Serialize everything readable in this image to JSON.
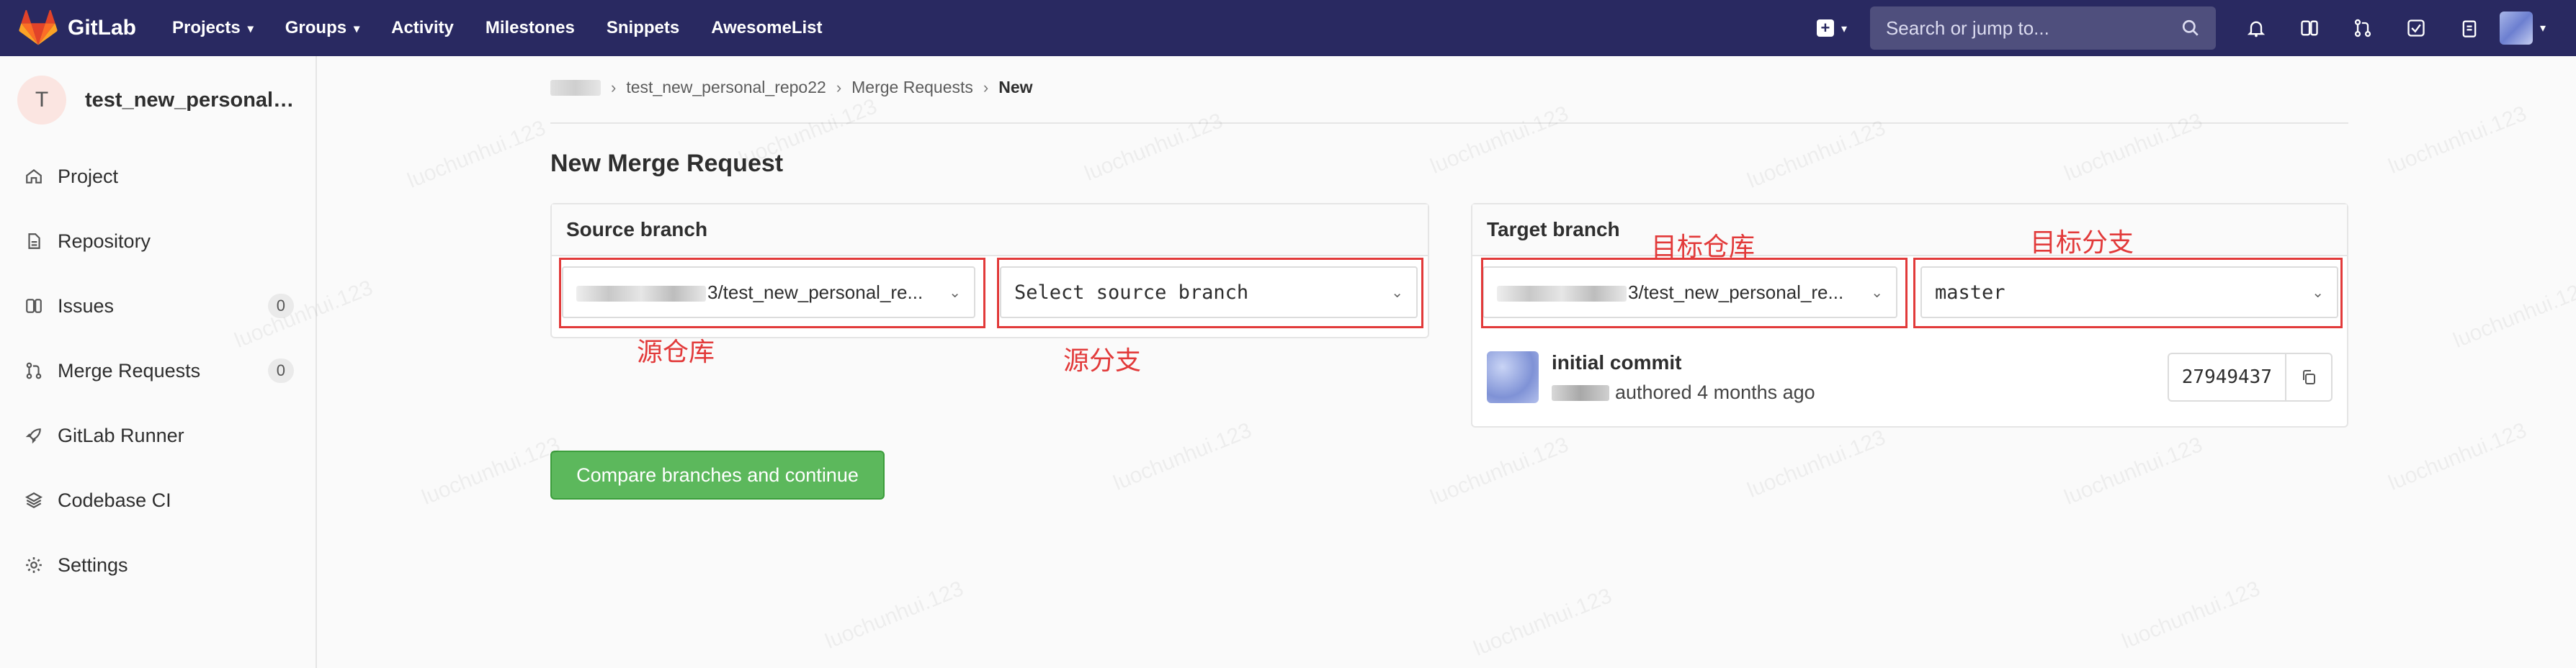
{
  "topnav": {
    "brand": "GitLab",
    "links": [
      {
        "label": "Projects",
        "has_dropdown": true
      },
      {
        "label": "Groups",
        "has_dropdown": true
      },
      {
        "label": "Activity",
        "has_dropdown": false
      },
      {
        "label": "Milestones",
        "has_dropdown": false
      },
      {
        "label": "Snippets",
        "has_dropdown": false
      },
      {
        "label": "AwesomeList",
        "has_dropdown": false
      }
    ],
    "search_placeholder": "Search or jump to...",
    "icons": [
      "plus-icon",
      "search-icon",
      "issues-icon",
      "todo-icon",
      "merge-request-icon",
      "check-icon",
      "clipboard-icon",
      "user-avatar"
    ]
  },
  "sidebar": {
    "avatar_letter": "T",
    "project_name": "test_new_personal_...",
    "items": [
      {
        "label": "Project",
        "icon": "home-icon"
      },
      {
        "label": "Repository",
        "icon": "document-icon"
      },
      {
        "label": "Issues",
        "icon": "issues-icon",
        "count": "0"
      },
      {
        "label": "Merge Requests",
        "icon": "merge-request-icon",
        "count": "0"
      },
      {
        "label": "GitLab Runner",
        "icon": "rocket-icon"
      },
      {
        "label": "Codebase CI",
        "icon": "layers-icon"
      },
      {
        "label": "Settings",
        "icon": "gear-icon"
      }
    ]
  },
  "breadcrumb": {
    "repo": "test_new_personal_repo22",
    "section": "Merge Requests",
    "current": "New"
  },
  "page_title": "New Merge Request",
  "source": {
    "header": "Source branch",
    "project_suffix": "3/test_new_personal_re...",
    "branch_placeholder": "Select source branch",
    "annotation_project": "源仓库",
    "annotation_branch": "源分支"
  },
  "target": {
    "header": "Target branch",
    "project_suffix": "3/test_new_personal_re...",
    "branch_value": "master",
    "annotation_project": "目标仓库",
    "annotation_branch": "目标分支",
    "commit_title": "initial commit",
    "commit_meta": "authored 4 months ago",
    "commit_sha": "27949437"
  },
  "submit_label": "Compare branches and continue",
  "watermark_text": "luochunhui.123",
  "colors": {
    "nav_bg": "#292961",
    "annotation_red": "#e23a3a",
    "submit_green": "#5cb85c"
  }
}
